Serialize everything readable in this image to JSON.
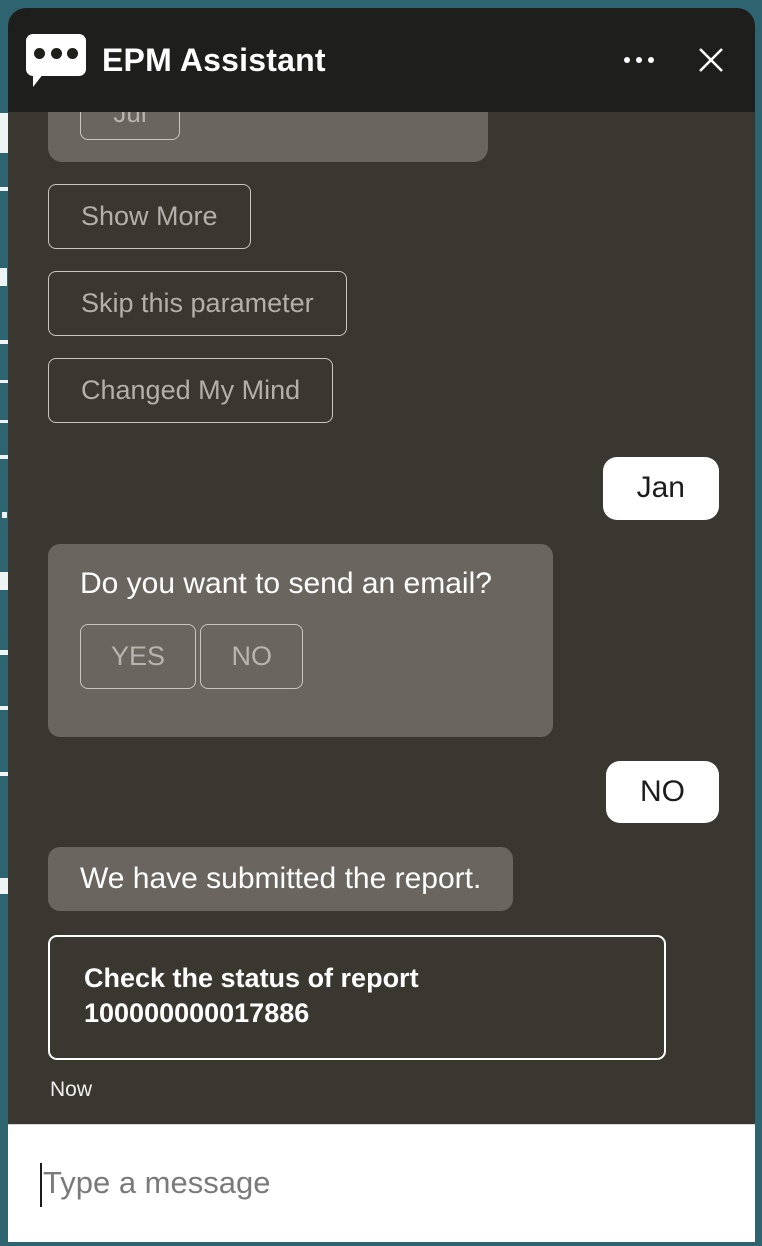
{
  "theme": {
    "backdrop_teal": "#2d6470",
    "panel_background": "#3a3730",
    "header_background": "#1e1e1c",
    "bot_bubble": "#6b6560",
    "user_bubble": "#ffffff",
    "outline": "#c9c5c0",
    "muted_text": "#b3afaa"
  },
  "header": {
    "logo_icon": "chat-bubble-icon",
    "title": "EPM Assistant",
    "menu_icon": "ellipsis-icon",
    "close_icon": "close-icon"
  },
  "conversation": {
    "clipped_chip_label": "Jul",
    "choices": [
      {
        "label": "Show More"
      },
      {
        "label": "Skip this parameter"
      },
      {
        "label": "Changed My Mind"
      }
    ],
    "user_month_reply": "Jan",
    "email_question": {
      "text": "Do you want to send an email?",
      "yes_label": "YES",
      "no_label": "NO"
    },
    "user_email_reply": "NO",
    "submitted_message": "We have submitted the report.",
    "status_action": {
      "line1": "Check the status of report",
      "line2": "100000000017886"
    },
    "timestamp": "Now"
  },
  "composer": {
    "placeholder": "Type a message",
    "value": ""
  }
}
